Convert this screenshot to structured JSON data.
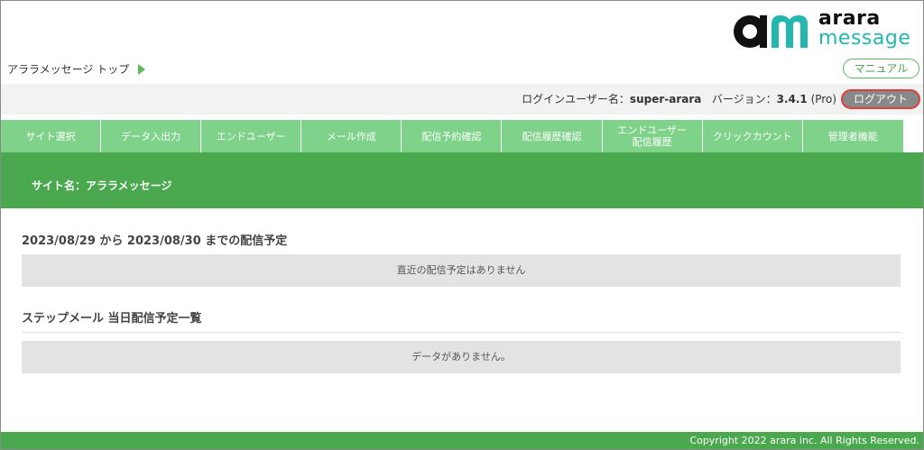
{
  "header": {
    "logo_arara": "arara",
    "logo_message": "message",
    "logo_mark": "am"
  },
  "breadcrumb": {
    "label": "アララメッセージ トップ"
  },
  "manual_button": "マニュアル",
  "user_bar": {
    "login_user_label": "ログインユーザー名：",
    "login_user_value": "super-arara",
    "version_label": "バージョン：",
    "version_value": "3.4.1",
    "edition": "(Pro)",
    "logout_button": "ログアウト"
  },
  "nav": {
    "items": [
      {
        "label": "サイト選択"
      },
      {
        "label": "データ入出力"
      },
      {
        "label": "エンドユーザー"
      },
      {
        "label": "メール作成"
      },
      {
        "label": "配信予約確認"
      },
      {
        "label": "配信履歴確認"
      },
      {
        "label": "エンドユーザー\n配信履歴"
      },
      {
        "label": "クリックカウント"
      },
      {
        "label": "管理者機能"
      }
    ]
  },
  "site": {
    "name": "サイト名：アララメッセージ"
  },
  "sections": [
    {
      "title": "2023/08/29 から 2023/08/30 までの配信予定",
      "empty_message": "直近の配信予定はありません"
    },
    {
      "title": "ステップメール 当日配信予定一覧",
      "empty_message": "データがありません。"
    }
  ],
  "footer": {
    "copyright": "Copyright 2022 arara inc. All Rights Reserved."
  },
  "colors": {
    "nav_green": "#7fd28a",
    "band_green": "#4aa94f",
    "logo_teal": "#22b8b0",
    "logout_border": "#e0403a"
  }
}
